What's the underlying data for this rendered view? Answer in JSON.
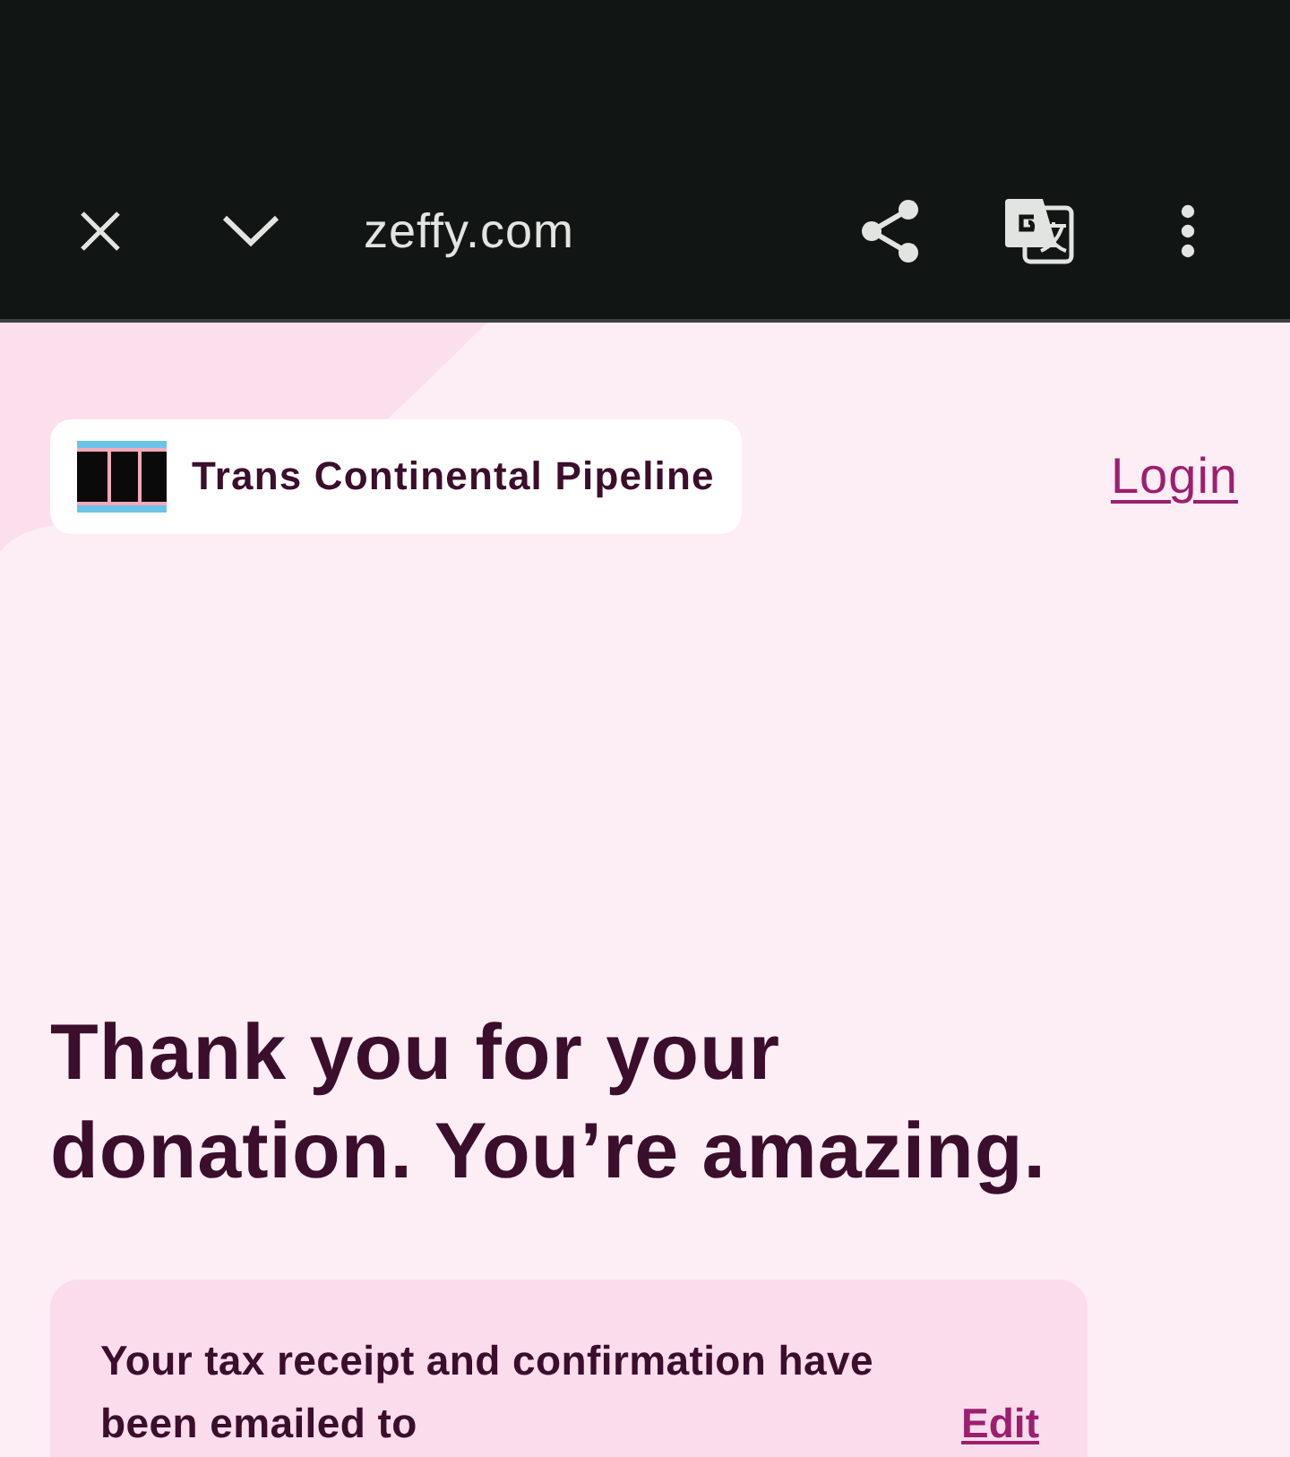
{
  "browser_bar": {
    "url": "zeffy.com"
  },
  "header": {
    "organization": "Trans Continental Pipeline",
    "login_link": "Login"
  },
  "heading": "Thank you for your donation. You’re amazing.",
  "receipt_card": {
    "message": "Your tax receipt and confirmation have been emailed to",
    "edit_link": "Edit"
  }
}
